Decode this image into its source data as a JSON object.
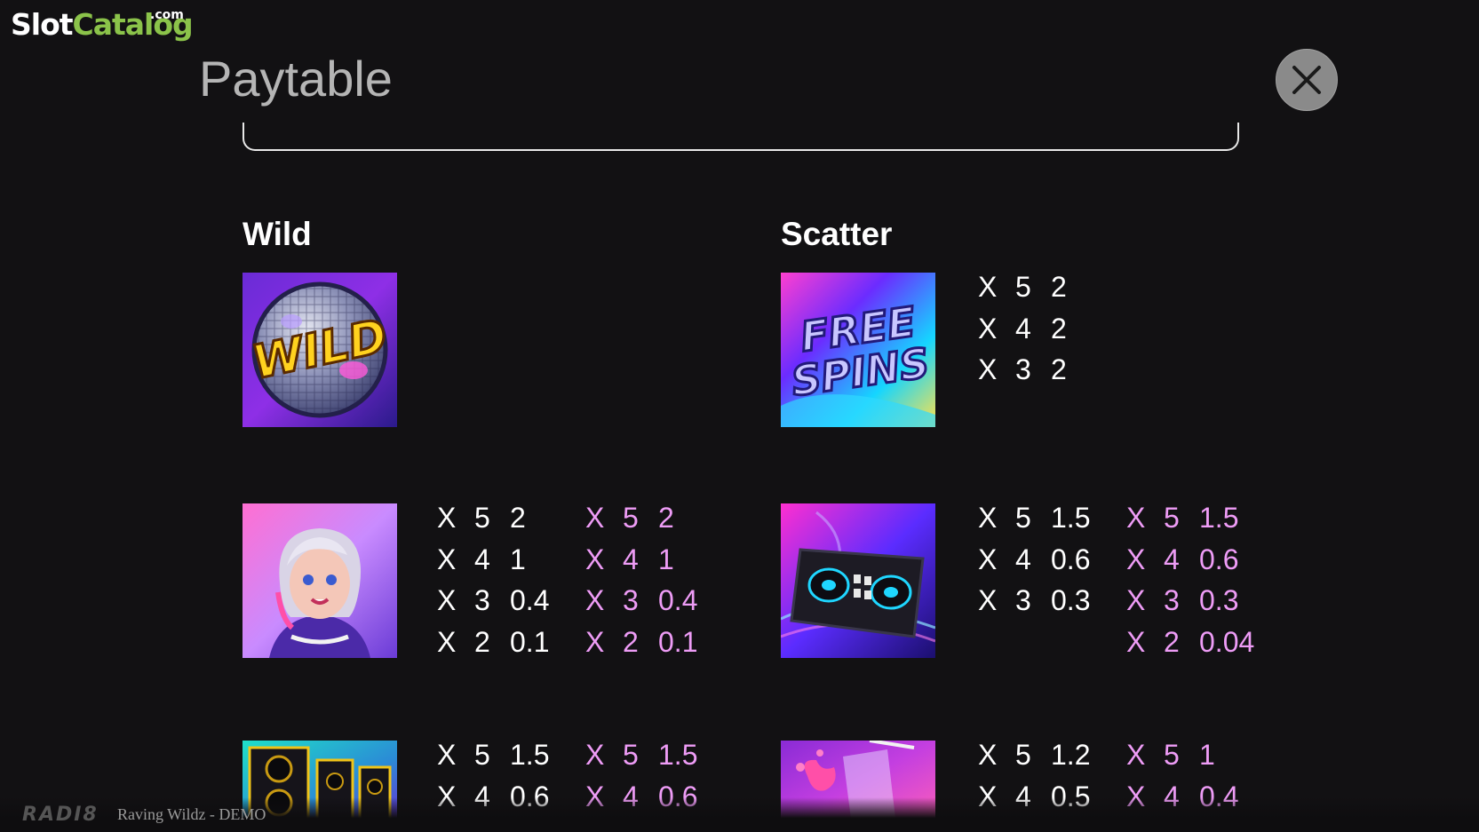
{
  "watermark": {
    "part1": "Slot",
    "part2": "Catalog",
    "suffix": ".com"
  },
  "header": {
    "title": "Paytable"
  },
  "sections": {
    "wild": "Wild",
    "scatter": "Scatter"
  },
  "icons": {
    "close": "close-icon"
  },
  "symbols": {
    "wild_label": "WILD",
    "freespins_label1": "FREE",
    "freespins_label2": "SPINS"
  },
  "paytables": {
    "scatter": [
      {
        "x": "X",
        "count": "5",
        "value": "2"
      },
      {
        "x": "X",
        "count": "4",
        "value": "2"
      },
      {
        "x": "X",
        "count": "3",
        "value": "2"
      }
    ],
    "girl_white": [
      {
        "x": "X",
        "count": "5",
        "value": "2"
      },
      {
        "x": "X",
        "count": "4",
        "value": "1"
      },
      {
        "x": "X",
        "count": "3",
        "value": "0.4"
      },
      {
        "x": "X",
        "count": "2",
        "value": "0.1"
      }
    ],
    "girl_pink": [
      {
        "x": "X",
        "count": "5",
        "value": "2"
      },
      {
        "x": "X",
        "count": "4",
        "value": "1"
      },
      {
        "x": "X",
        "count": "3",
        "value": "0.4"
      },
      {
        "x": "X",
        "count": "2",
        "value": "0.1"
      }
    ],
    "dj_white": [
      {
        "x": "X",
        "count": "5",
        "value": "1.5"
      },
      {
        "x": "X",
        "count": "4",
        "value": "0.6"
      },
      {
        "x": "X",
        "count": "3",
        "value": "0.3"
      }
    ],
    "dj_pink": [
      {
        "x": "X",
        "count": "5",
        "value": "1.5"
      },
      {
        "x": "X",
        "count": "4",
        "value": "0.6"
      },
      {
        "x": "X",
        "count": "3",
        "value": "0.3"
      },
      {
        "x": "X",
        "count": "2",
        "value": "0.04"
      }
    ],
    "speaker_white": [
      {
        "x": "X",
        "count": "5",
        "value": "1.5"
      },
      {
        "x": "X",
        "count": "4",
        "value": "0.6"
      }
    ],
    "speaker_pink": [
      {
        "x": "X",
        "count": "5",
        "value": "1.5"
      },
      {
        "x": "X",
        "count": "4",
        "value": "0.6"
      }
    ],
    "drink_white": [
      {
        "x": "X",
        "count": "5",
        "value": "1.2"
      },
      {
        "x": "X",
        "count": "4",
        "value": "0.5"
      }
    ],
    "drink_pink": [
      {
        "x": "X",
        "count": "5",
        "value": "1"
      },
      {
        "x": "X",
        "count": "4",
        "value": "0.4"
      }
    ]
  },
  "footer": {
    "brand": "RADI8",
    "game": "Raving Wildz - DEMO"
  },
  "colors": {
    "background": "#121113",
    "pink_pay": "#ee9cf6",
    "white_pay": "#ffffff",
    "watermark_green": "#8bc34a"
  }
}
